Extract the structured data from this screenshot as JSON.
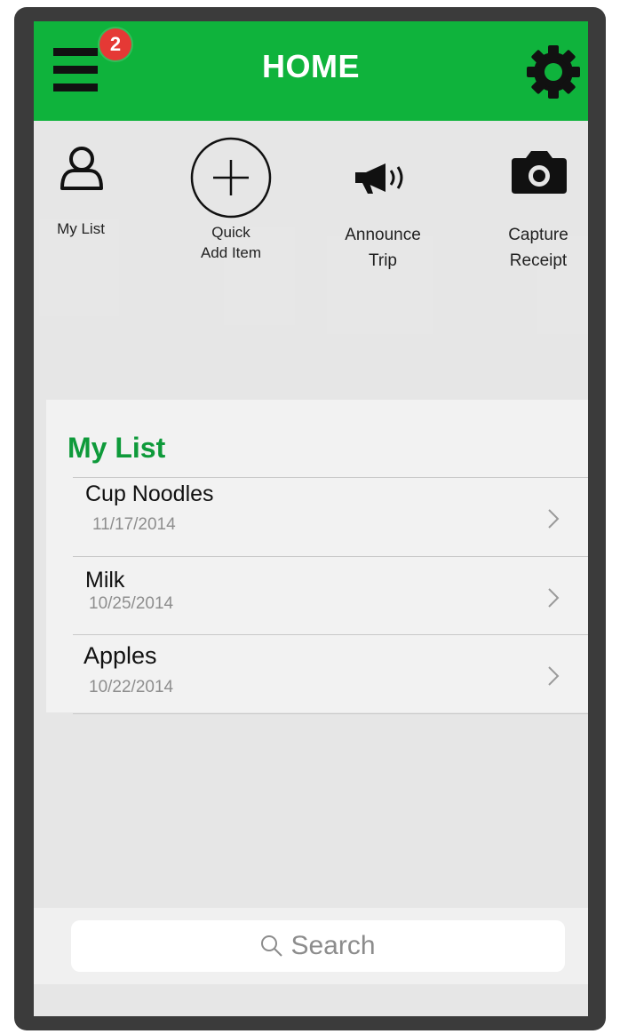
{
  "header": {
    "title": "HOME",
    "notification_count": "2",
    "menu_icon": "hamburger-menu-icon",
    "settings_icon": "gear-icon"
  },
  "actions": [
    {
      "label": "My List",
      "icon": "user-icon"
    },
    {
      "label_line1": "Quick",
      "label_line2": "Add Item",
      "icon": "plus-circle-icon"
    },
    {
      "label_line1": "Announce",
      "label_line2": "Trip",
      "icon": "megaphone-icon"
    },
    {
      "label_line1": "Capture",
      "label_line2": "Receipt",
      "icon": "camera-icon"
    }
  ],
  "my_list": {
    "title": "My List",
    "items": [
      {
        "name": "Cup Noodles",
        "date": "11/17/2014"
      },
      {
        "name": "Milk",
        "date": "10/25/2014"
      },
      {
        "name": "Apples",
        "date": "10/22/2014"
      }
    ]
  },
  "search": {
    "placeholder": "Search",
    "icon": "search-icon"
  },
  "colors": {
    "header_green": "#0fb33c",
    "title_green": "#0e9a3a",
    "badge_red": "#e53935",
    "background": "#e6e6e6"
  }
}
